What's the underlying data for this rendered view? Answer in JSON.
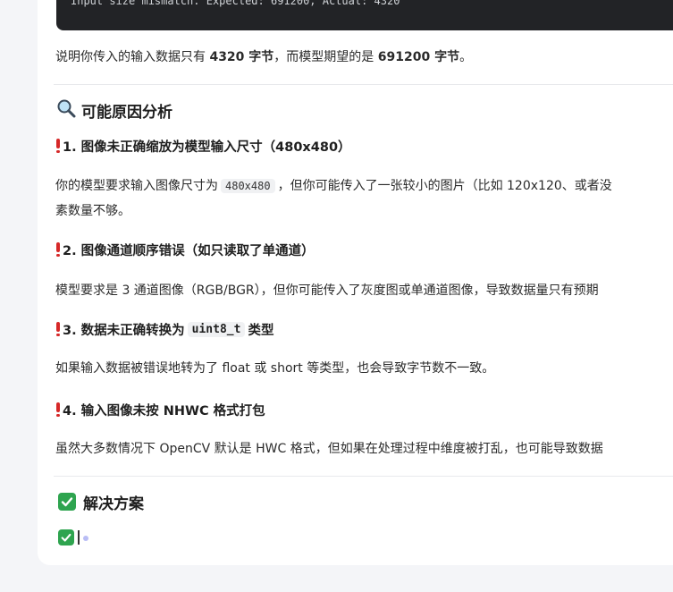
{
  "code_output": "Input size mismatch. Expected: 691200, Actual: 4320",
  "explanation": {
    "prefix": "说明你传入的输入数据只有 ",
    "actual_bytes": "4320 字节",
    "middle": "，而模型期望的是 ",
    "expected_bytes": "691200 字节",
    "suffix": "。"
  },
  "causes_section": {
    "title": "可能原因分析",
    "icon": "search-icon"
  },
  "causes": [
    {
      "heading": "1. 图像未正确缩放为模型输入尺寸（480x480）",
      "line1_prefix": "你的模型要求输入图像尺寸为",
      "line1_code": "480x480",
      "line1_suffix": "，但你可能传入了一张较小的图片（比如 120x120、或者没",
      "line2": "素数量不够。"
    },
    {
      "heading": "2. 图像通道顺序错误（如只读取了单通道）",
      "body": "模型要求是 3 通道图像（RGB/BGR），但你可能传入了灰度图或单通道图像，导致数据量只有预期"
    },
    {
      "heading_prefix": "3. 数据未正确转换为",
      "heading_code": "uint8_t",
      "heading_suffix": "类型",
      "body": "如果输入数据被错误地转为了 float 或 short 等类型，也会导致字节数不一致。"
    },
    {
      "heading": "4. 输入图像未按 NHWC 格式打包",
      "body": "虽然大多数情况下 OpenCV 默认是 HWC 格式，但如果在处理过程中维度被打乱，也可能导致数据"
    }
  ],
  "solution_section": {
    "title": "解决方案",
    "icon": "check-icon"
  },
  "colors": {
    "accent_check": "#2ea44f",
    "exclamation": "#d62828",
    "code_bg": "#222326"
  }
}
